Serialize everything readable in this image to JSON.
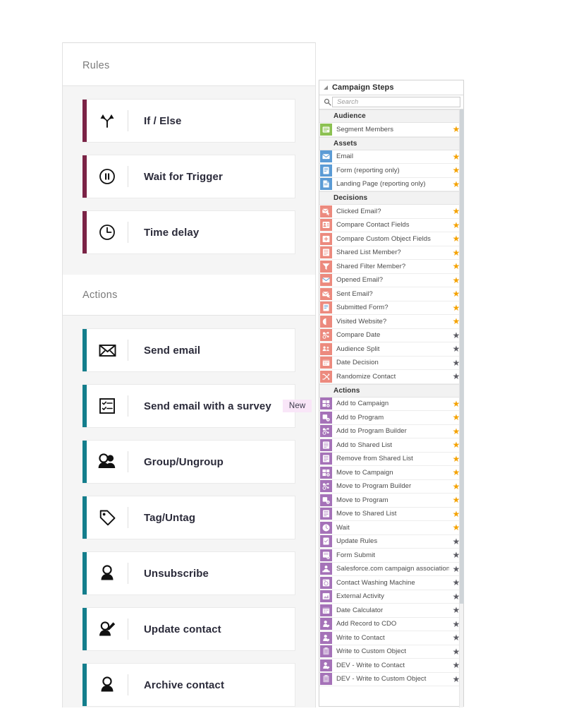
{
  "left_panel": {
    "sections": [
      {
        "id": "rules",
        "title": "Rules",
        "accent": "#7b2346",
        "items": [
          {
            "label": "If / Else",
            "icon": "branch-icon",
            "badge": ""
          },
          {
            "label": "Wait for Trigger",
            "icon": "pause-circle-icon",
            "badge": ""
          },
          {
            "label": "Time delay",
            "icon": "clock-icon",
            "badge": ""
          }
        ]
      },
      {
        "id": "actions",
        "title": "Actions",
        "accent": "#147e8c",
        "items": [
          {
            "label": "Send email",
            "icon": "envelope-icon",
            "badge": ""
          },
          {
            "label": "Send email with a survey",
            "icon": "survey-checklist-icon",
            "badge": "New"
          },
          {
            "label": "Group/Ungroup",
            "icon": "people-group-icon",
            "badge": ""
          },
          {
            "label": "Tag/Untag",
            "icon": "tag-icon",
            "badge": ""
          },
          {
            "label": "Unsubscribe",
            "icon": "person-icon",
            "badge": ""
          },
          {
            "label": "Update contact",
            "icon": "person-edit-icon",
            "badge": ""
          },
          {
            "label": "Archive contact",
            "icon": "person-icon",
            "badge": ""
          }
        ]
      }
    ]
  },
  "right_panel": {
    "title": "Campaign Steps",
    "collapse_icon": "collapse-triangle-icon",
    "search": {
      "icon": "search-icon",
      "placeholder": "Search",
      "value": ""
    },
    "star_on_color": "#f5a303",
    "star_off_color": "#5d5d65",
    "groups": [
      {
        "name": "Audience",
        "icon_color": "#8cc152",
        "items": [
          {
            "label": "Segment Members",
            "icon": "segment-members-icon",
            "starred": true
          }
        ]
      },
      {
        "name": "Assets",
        "icon_color": "#5b9bd5",
        "items": [
          {
            "label": "Email",
            "icon": "email-icon",
            "starred": true
          },
          {
            "label": "Form (reporting only)",
            "icon": "form-icon",
            "starred": true
          },
          {
            "label": "Landing Page (reporting only)",
            "icon": "landing-page-icon",
            "starred": true
          }
        ]
      },
      {
        "name": "Decisions",
        "icon_color": "#ec8a7e",
        "items": [
          {
            "label": "Clicked Email?",
            "icon": "clicked-email-icon",
            "starred": true
          },
          {
            "label": "Compare Contact Fields",
            "icon": "compare-contact-fields-icon",
            "starred": true
          },
          {
            "label": "Compare Custom Object Fields",
            "icon": "compare-custom-object-fields-icon",
            "starred": true
          },
          {
            "label": "Shared List Member?",
            "icon": "shared-list-icon",
            "starred": true
          },
          {
            "label": "Shared Filter Member?",
            "icon": "filter-icon",
            "starred": true
          },
          {
            "label": "Opened Email?",
            "icon": "opened-email-icon",
            "starred": true
          },
          {
            "label": "Sent Email?",
            "icon": "sent-email-icon",
            "starred": true
          },
          {
            "label": "Submitted Form?",
            "icon": "submitted-form-icon",
            "starred": true
          },
          {
            "label": "Visited Website?",
            "icon": "visited-website-icon",
            "starred": true
          },
          {
            "label": "Compare Date",
            "icon": "compare-date-icon",
            "starred": false
          },
          {
            "label": "Audience Split",
            "icon": "audience-split-icon",
            "starred": false
          },
          {
            "label": "Date Decision",
            "icon": "date-decision-icon",
            "starred": false
          },
          {
            "label": "Randomize Contact",
            "icon": "randomize-contact-icon",
            "starred": false
          }
        ]
      },
      {
        "name": "Actions",
        "icon_color": "#a572b8",
        "items": [
          {
            "label": "Add to Campaign",
            "icon": "add-to-campaign-icon",
            "starred": true
          },
          {
            "label": "Add to Program",
            "icon": "add-to-program-icon",
            "starred": true
          },
          {
            "label": "Add to Program Builder",
            "icon": "add-to-program-builder-icon",
            "starred": true
          },
          {
            "label": "Add to Shared List",
            "icon": "add-to-shared-list-icon",
            "starred": true
          },
          {
            "label": "Remove from Shared List",
            "icon": "remove-from-shared-list-icon",
            "starred": true
          },
          {
            "label": "Move to Campaign",
            "icon": "move-to-campaign-icon",
            "starred": true
          },
          {
            "label": "Move to Program Builder",
            "icon": "move-to-program-builder-icon",
            "starred": true
          },
          {
            "label": "Move to Program",
            "icon": "move-to-program-icon",
            "starred": true
          },
          {
            "label": "Move to Shared List",
            "icon": "move-to-shared-list-icon",
            "starred": true
          },
          {
            "label": "Wait",
            "icon": "wait-clock-icon",
            "starred": true
          },
          {
            "label": "Update Rules",
            "icon": "update-rules-icon",
            "starred": false
          },
          {
            "label": "Form Submit",
            "icon": "form-submit-icon",
            "starred": false
          },
          {
            "label": "Salesforce.com campaign association",
            "icon": "salesforce-icon",
            "starred": false
          },
          {
            "label": "Contact Washing Machine",
            "icon": "contact-washing-machine-icon",
            "starred": false
          },
          {
            "label": "External Activity",
            "icon": "external-activity-icon",
            "starred": false
          },
          {
            "label": "Date Calculator",
            "icon": "date-calculator-icon",
            "starred": false
          },
          {
            "label": "Add Record to CDO",
            "icon": "add-record-to-cdo-icon",
            "starred": false
          },
          {
            "label": "Write to Contact",
            "icon": "write-to-contact-icon",
            "starred": false
          },
          {
            "label": "Write to Custom Object",
            "icon": "write-to-custom-object-icon",
            "starred": false
          },
          {
            "label": "DEV - Write to Contact",
            "icon": "dev-write-to-contact-icon",
            "starred": false
          },
          {
            "label": "DEV - Write to Custom Object",
            "icon": "dev-write-to-custom-object-icon",
            "starred": false
          }
        ]
      }
    ]
  }
}
